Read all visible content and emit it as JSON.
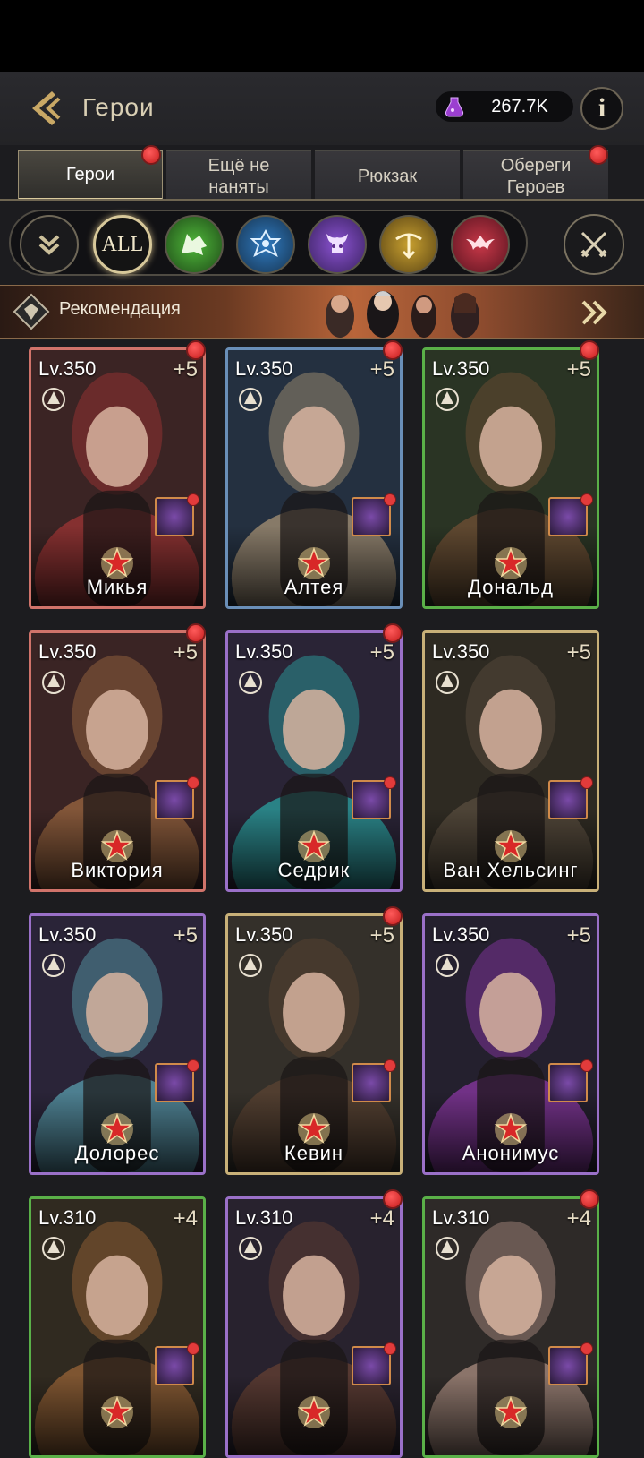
{
  "header": {
    "title": "Герои",
    "currency_value": "267.7K",
    "info_label": "i"
  },
  "tabs": [
    {
      "label": "Герои",
      "active": true,
      "badge": true
    },
    {
      "label": "Ещё не\nнаняты",
      "active": false,
      "badge": false
    },
    {
      "label": "Рюкзак",
      "active": false,
      "badge": false
    },
    {
      "label": "Обереги\nГероев",
      "active": false,
      "badge": true
    }
  ],
  "filters": {
    "all_label": "ALL",
    "classes": [
      {
        "icon": "wolf-icon",
        "color": "#3f9a2e"
      },
      {
        "icon": "eye-icon",
        "color": "#2a74b8"
      },
      {
        "icon": "demon-skull-icon",
        "color": "#7a48c0"
      },
      {
        "icon": "crossbow-icon",
        "color": "#b8922c"
      },
      {
        "icon": "bat-icon",
        "color": "#b83040"
      }
    ]
  },
  "recommendation": {
    "label": "Рекомендация"
  },
  "heroes": [
    {
      "level": "Lv.350",
      "bonus": "+5",
      "name": "Микья",
      "frame": "#d0736a",
      "bg": "#3b2424",
      "accent": "#c23a3a",
      "badge": true,
      "item_icon": "drill-icon"
    },
    {
      "level": "Lv.350",
      "bonus": "+5",
      "name": "Алтея",
      "frame": "#6a8fb8",
      "bg": "#243040",
      "accent": "#d8b888",
      "badge": true,
      "item_icon": "book-icon"
    },
    {
      "level": "Lv.350",
      "bonus": "+5",
      "name": "Дональд",
      "frame": "#5ab048",
      "bg": "#2a3424",
      "accent": "#8a5a3a",
      "badge": true,
      "item_icon": "horn-icon"
    },
    {
      "level": "Lv.350",
      "bonus": "+5",
      "name": "Виктория",
      "frame": "#d0736a",
      "bg": "#3a2424",
      "accent": "#c0804a",
      "badge": true,
      "item_icon": "crown-icon"
    },
    {
      "level": "Lv.350",
      "bonus": "+5",
      "name": "Седрик",
      "frame": "#9a70c8",
      "bg": "#2a2436",
      "accent": "#2ad0c8",
      "badge": true,
      "item_icon": "sickle-icon"
    },
    {
      "level": "Lv.350",
      "bonus": "+5",
      "name": "Ван Хельсинг",
      "frame": "#c8b078",
      "bg": "#2e2a22",
      "accent": "#6a5a48",
      "badge": false,
      "item_icon": "tome-icon"
    },
    {
      "level": "Lv.350",
      "bonus": "+5",
      "name": "Долорес",
      "frame": "#9a70c8",
      "bg": "#2a2438",
      "accent": "#6acad8",
      "badge": false,
      "item_icon": "goblet-icon"
    },
    {
      "level": "Lv.350",
      "bonus": "+5",
      "name": "Кевин",
      "frame": "#c8b078",
      "bg": "#34302a",
      "accent": "#6a4a34",
      "badge": true,
      "item_icon": "book-icon"
    },
    {
      "level": "Lv.350",
      "bonus": "+5",
      "name": "Анонимус",
      "frame": "#9a70c8",
      "bg": "#24202e",
      "accent": "#b040d0",
      "badge": false,
      "item_icon": "hook-icon"
    },
    {
      "level": "Lv.310",
      "bonus": "+4",
      "name": "",
      "frame": "#5ab048",
      "bg": "#302a20",
      "accent": "#c07840",
      "badge": false,
      "item_icon": "bracelet-icon"
    },
    {
      "level": "Lv.310",
      "bonus": "+4",
      "name": "",
      "frame": "#9a70c8",
      "bg": "#28222e",
      "accent": "#7a4a34",
      "badge": true,
      "item_icon": "tome-icon"
    },
    {
      "level": "Lv.310",
      "bonus": "+4",
      "name": "",
      "frame": "#5ab048",
      "bg": "#2e2a28",
      "accent": "#d8b0a0",
      "badge": true,
      "item_icon": "pistol-icon"
    }
  ]
}
